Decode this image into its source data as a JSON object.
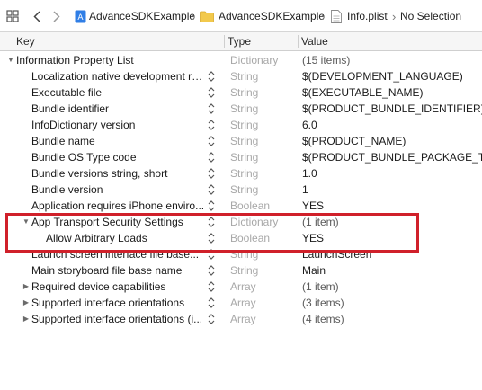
{
  "breadcrumb": {
    "project": "AdvanceSDKExample",
    "folder": "AdvanceSDKExample",
    "file": "Info.plist",
    "selection": "No Selection"
  },
  "columns": {
    "key": "Key",
    "type": "Type",
    "value": "Value"
  },
  "rows": [
    {
      "key": "Information Property List",
      "type": "Dictionary",
      "value": "(15 items)",
      "disclosure": "expanded",
      "level": 0
    },
    {
      "key": "Localization native development re...",
      "type": "String",
      "value": "$(DEVELOPMENT_LANGUAGE)",
      "level": 1
    },
    {
      "key": "Executable file",
      "type": "String",
      "value": "$(EXECUTABLE_NAME)",
      "level": 1
    },
    {
      "key": "Bundle identifier",
      "type": "String",
      "value": "$(PRODUCT_BUNDLE_IDENTIFIER)",
      "level": 1
    },
    {
      "key": "InfoDictionary version",
      "type": "String",
      "value": "6.0",
      "level": 1
    },
    {
      "key": "Bundle name",
      "type": "String",
      "value": "$(PRODUCT_NAME)",
      "level": 1
    },
    {
      "key": "Bundle OS Type code",
      "type": "String",
      "value": "$(PRODUCT_BUNDLE_PACKAGE_TYPE)",
      "level": 1
    },
    {
      "key": "Bundle versions string, short",
      "type": "String",
      "value": "1.0",
      "level": 1
    },
    {
      "key": "Bundle version",
      "type": "String",
      "value": "1",
      "level": 1
    },
    {
      "key": "Application requires iPhone enviro...",
      "type": "Boolean",
      "value": "YES",
      "level": 1
    },
    {
      "key": "App Transport Security Settings",
      "type": "Dictionary",
      "value": "(1 item)",
      "disclosure": "expanded",
      "level": 1
    },
    {
      "key": "Allow Arbitrary Loads",
      "type": "Boolean",
      "value": "YES",
      "level": 2
    },
    {
      "key": "Launch screen interface file base...",
      "type": "String",
      "value": "LaunchScreen",
      "level": 1
    },
    {
      "key": "Main storyboard file base name",
      "type": "String",
      "value": "Main",
      "level": 1
    },
    {
      "key": "Required device capabilities",
      "type": "Array",
      "value": "(1 item)",
      "disclosure": "collapsed",
      "level": 1
    },
    {
      "key": "Supported interface orientations",
      "type": "Array",
      "value": "(3 items)",
      "disclosure": "collapsed",
      "level": 1
    },
    {
      "key": "Supported interface orientations (i...",
      "type": "Array",
      "value": "(4 items)",
      "disclosure": "collapsed",
      "level": 1
    }
  ],
  "colors": {
    "highlight": "#d0202a",
    "type_text": "#a8a8a8"
  }
}
